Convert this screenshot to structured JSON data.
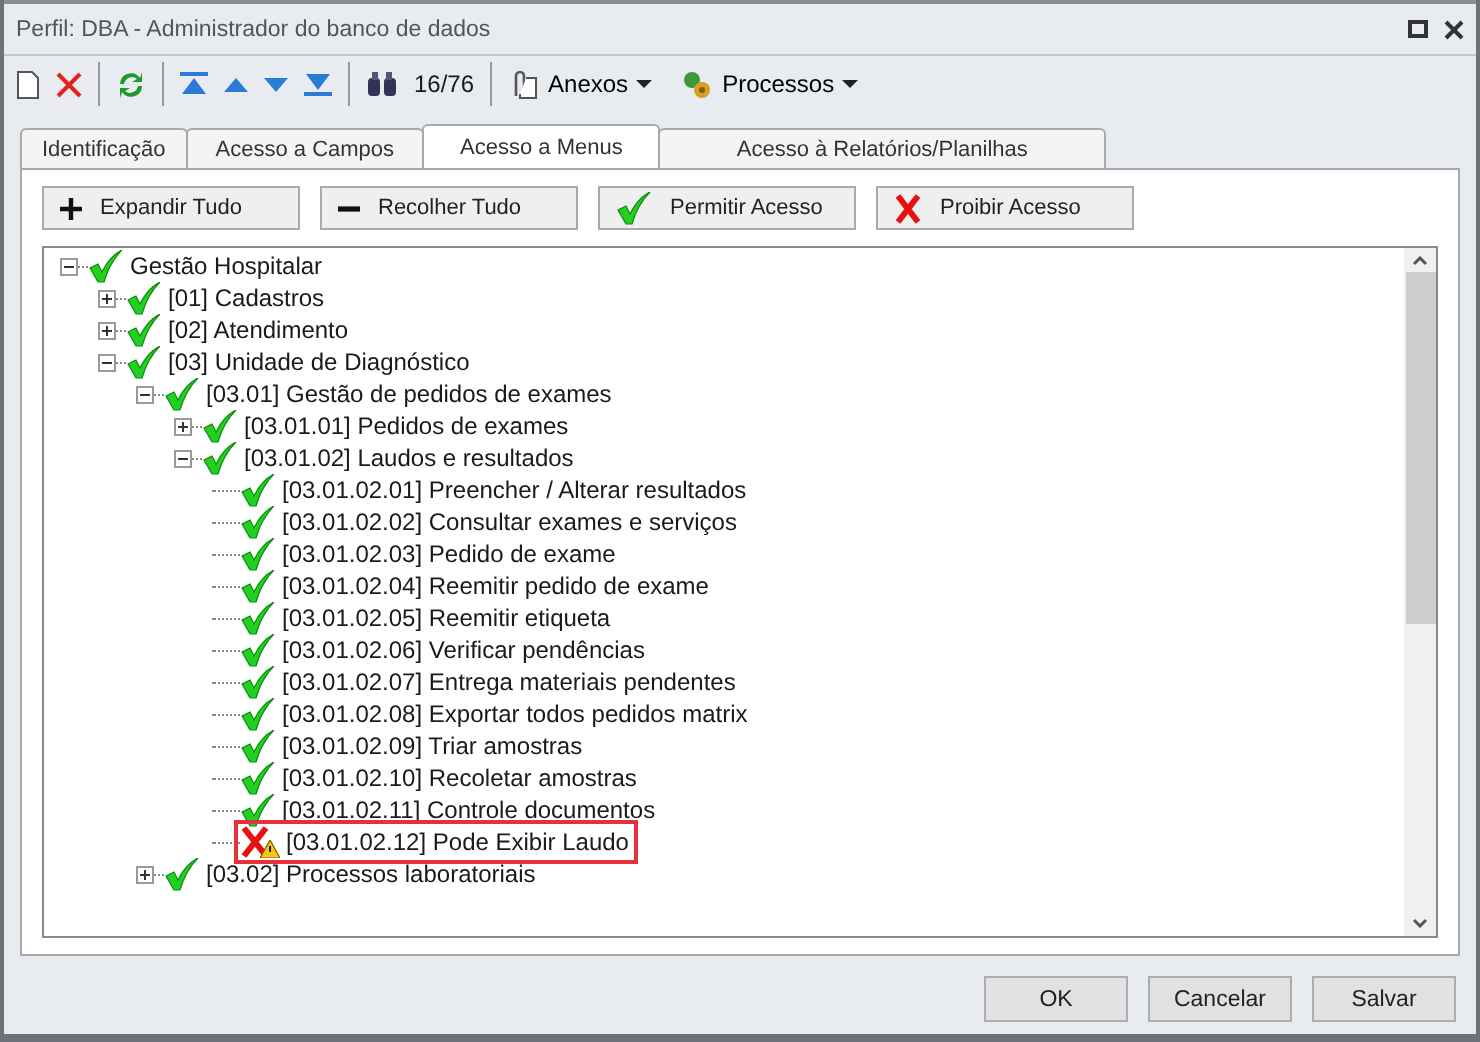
{
  "window": {
    "title": "Perfil: DBA - Administrador do banco de dados"
  },
  "toolbar": {
    "counter": "16/76",
    "menus": [
      "Anexos",
      "Processos"
    ]
  },
  "tabs": [
    {
      "label": "Identificação",
      "selected": false
    },
    {
      "label": "Acesso a Campos",
      "selected": false
    },
    {
      "label": "Acesso a Menus",
      "selected": true
    },
    {
      "label": "Acesso à Relatórios/Planilhas",
      "selected": false
    }
  ],
  "actions": [
    {
      "label": "Expandir Tudo",
      "kind": "expand"
    },
    {
      "label": "Recolher Tudo",
      "kind": "collapse"
    },
    {
      "label": "Permitir Acesso",
      "kind": "allow"
    },
    {
      "label": "Proibir Acesso",
      "kind": "deny"
    }
  ],
  "tree": [
    {
      "label": "Gestão Hospitalar",
      "allowed": true,
      "expanded": true,
      "children": [
        {
          "label": "[01] Cadastros",
          "allowed": true,
          "expanded": false,
          "has_children": true
        },
        {
          "label": "[02] Atendimento",
          "allowed": true,
          "expanded": false,
          "has_children": true
        },
        {
          "label": "[03] Unidade de Diagnóstico",
          "allowed": true,
          "expanded": true,
          "children": [
            {
              "label": "[03.01] Gestão de pedidos de exames",
              "allowed": true,
              "expanded": true,
              "children": [
                {
                  "label": "[03.01.01] Pedidos de exames",
                  "allowed": true,
                  "expanded": false,
                  "has_children": true
                },
                {
                  "label": "[03.01.02] Laudos e resultados",
                  "allowed": true,
                  "expanded": true,
                  "children": [
                    {
                      "label": "[03.01.02.01] Preencher / Alterar resultados",
                      "allowed": true
                    },
                    {
                      "label": "[03.01.02.02] Consultar exames e serviços",
                      "allowed": true
                    },
                    {
                      "label": "[03.01.02.03] Pedido de exame",
                      "allowed": true
                    },
                    {
                      "label": "[03.01.02.04] Reemitir pedido de exame",
                      "allowed": true
                    },
                    {
                      "label": "[03.01.02.05] Reemitir etiqueta",
                      "allowed": true
                    },
                    {
                      "label": "[03.01.02.06] Verificar pendências",
                      "allowed": true
                    },
                    {
                      "label": "[03.01.02.07] Entrega materiais pendentes",
                      "allowed": true
                    },
                    {
                      "label": "[03.01.02.08] Exportar todos pedidos matrix",
                      "allowed": true
                    },
                    {
                      "label": "[03.01.02.09] Triar amostras",
                      "allowed": true
                    },
                    {
                      "label": "[03.01.02.10] Recoletar amostras",
                      "allowed": true
                    },
                    {
                      "label": "[03.01.02.11] Controle documentos",
                      "allowed": true
                    },
                    {
                      "label": "[03.01.02.12] Pode Exibir Laudo",
                      "allowed": false,
                      "warning": true,
                      "highlighted": true
                    }
                  ]
                }
              ]
            },
            {
              "label": "[03.02] Processos laboratoriais",
              "allowed": true,
              "expanded": false,
              "has_children": true
            }
          ]
        }
      ]
    }
  ],
  "buttons": [
    "OK",
    "Cancelar",
    "Salvar"
  ]
}
